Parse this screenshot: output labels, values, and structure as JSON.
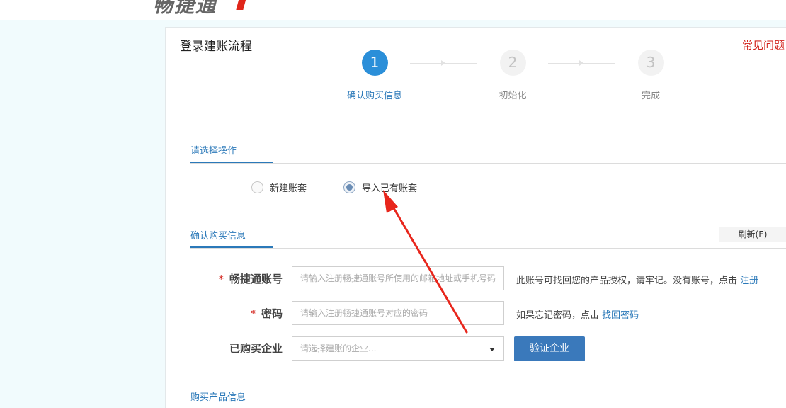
{
  "header": {
    "logo_text": "畅捷通"
  },
  "panel": {
    "title": "登录建账流程",
    "faq_link": "常见问题"
  },
  "steps": [
    {
      "number": "1",
      "label": "确认购买信息",
      "active": true
    },
    {
      "number": "2",
      "label": "初始化",
      "active": false
    },
    {
      "number": "3",
      "label": "完成",
      "active": false
    }
  ],
  "operation_section": {
    "title": "请选择操作",
    "options": [
      {
        "label": "新建账套",
        "checked": false
      },
      {
        "label": "导入已有账套",
        "checked": true
      }
    ]
  },
  "purchase_section": {
    "title": "确认购买信息",
    "refresh_label": "刷新(E)"
  },
  "form": {
    "account": {
      "required_mark": "*",
      "label": "畅捷通账号",
      "placeholder": "请输入注册畅捷通账号所使用的邮箱地址或手机号码",
      "hint": "此账号可找回您的产品授权，请牢记。没有账号，点击",
      "hint_link": "注册"
    },
    "password": {
      "required_mark": "*",
      "label": "密码",
      "placeholder": "请输入注册畅捷通账号对应的密码",
      "hint": "如果忘记密码，点击",
      "hint_link": "找回密码"
    },
    "company": {
      "label": "已购买企业",
      "placeholder": "请选择建账的企业..."
    },
    "verify_label": "验证企业"
  },
  "product_section": {
    "title": "购买产品信息"
  },
  "colors": {
    "accent": "#2b79b9",
    "step_active": "#2b8fd9",
    "annotation_arrow": "#e8261c",
    "button": "#3a79bb"
  }
}
